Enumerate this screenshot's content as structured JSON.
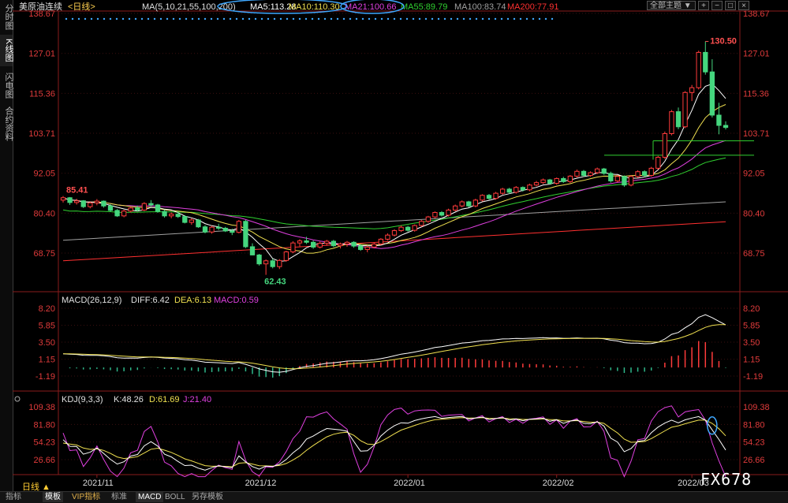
{
  "sidebar": {
    "tabs": [
      "分时图",
      "K线图",
      "闪电图",
      "合约资料"
    ],
    "active": 1
  },
  "toolbar": {
    "theme": "全部主题",
    "theme_arrow": "▼"
  },
  "main_chart": {
    "instrument": "美原油连续",
    "period": "<日线>",
    "ma_label": "MA(5,10,21,55,100,200)",
    "ma_items": [
      {
        "label": "MA5:113.28",
        "color": "#ffffff"
      },
      {
        "label": "MA10:110.30",
        "color": "#f0e050"
      },
      {
        "label": "MA21:100.66",
        "color": "#e040e0"
      },
      {
        "label": "MA55:89.79",
        "color": "#30d030"
      },
      {
        "label": "MA100:83.74",
        "color": "#a0a0a0"
      },
      {
        "label": "MA200:77.91",
        "color": "#ff3030"
      }
    ],
    "price_ticks": [
      "138.67",
      "127.01",
      "115.36",
      "103.71",
      "92.05",
      "80.40",
      "68.75"
    ],
    "high_label": "130.50",
    "low_label": "62.43",
    "start_label": "85.41"
  },
  "macd": {
    "title": "MACD(26,12,9)",
    "diff": "DIFF:6.42",
    "dea": "DEA:6.13",
    "macd": "MACD:0.59",
    "ticks": [
      "8.20",
      "5.85",
      "3.50",
      "1.15",
      "-1.19"
    ]
  },
  "kdj": {
    "title": "KDJ(9,3,3)",
    "k": "K:48.26",
    "d": "D:61.69",
    "j": "J:21.40",
    "ticks": [
      "109.38",
      "81.80",
      "54.23",
      "26.66"
    ]
  },
  "x_axis": {
    "labels": [
      "2021/11",
      "2021/12",
      "2022/01",
      "2022/02",
      "2022/03"
    ]
  },
  "bottom": {
    "period": "日线 ▲",
    "tabs": [
      "指标",
      "模板",
      "VIP指标",
      "标准",
      "MACD",
      "BOLL",
      "另存模板"
    ],
    "active_tabs": [
      1,
      4
    ]
  },
  "watermark": "FX678",
  "chart_data": {
    "type": "candlestick",
    "candles": [
      [
        84.2,
        85.4,
        83.5,
        84.9
      ],
      [
        84.9,
        85.1,
        82.8,
        83.5
      ],
      [
        83.5,
        84.6,
        82.9,
        84.0
      ],
      [
        84.0,
        84.2,
        81.9,
        82.3
      ],
      [
        82.3,
        83.7,
        81.8,
        83.4
      ],
      [
        83.4,
        84.5,
        82.7,
        83.9
      ],
      [
        83.9,
        84.1,
        82.0,
        82.5
      ],
      [
        82.5,
        83.0,
        80.8,
        81.2
      ],
      [
        81.2,
        81.6,
        79.3,
        79.6
      ],
      [
        79.6,
        81.4,
        79.2,
        81.0
      ],
      [
        81.0,
        82.3,
        80.6,
        81.9
      ],
      [
        81.9,
        82.6,
        80.9,
        81.3
      ],
      [
        81.3,
        83.6,
        81.0,
        83.2
      ],
      [
        83.2,
        84.2,
        82.3,
        82.8
      ],
      [
        82.8,
        83.1,
        80.5,
        80.9
      ],
      [
        80.9,
        81.4,
        79.1,
        79.6
      ],
      [
        79.6,
        80.6,
        78.9,
        80.1
      ],
      [
        80.1,
        80.9,
        79.0,
        79.4
      ],
      [
        79.4,
        79.8,
        77.4,
        77.7
      ],
      [
        77.7,
        78.9,
        77.0,
        78.4
      ],
      [
        78.4,
        78.7,
        76.1,
        76.4
      ],
      [
        76.4,
        76.9,
        74.5,
        74.9
      ],
      [
        74.9,
        76.7,
        74.4,
        76.3
      ],
      [
        76.3,
        77.3,
        75.5,
        76.0
      ],
      [
        76.0,
        76.4,
        74.9,
        75.2
      ],
      [
        75.2,
        75.9,
        74.0,
        74.8
      ],
      [
        74.8,
        78.4,
        74.5,
        78.0
      ],
      [
        78.0,
        78.4,
        70.2,
        70.6
      ],
      [
        70.6,
        71.6,
        68.1,
        68.2
      ],
      [
        68.2,
        68.5,
        65.1,
        65.6
      ],
      [
        65.6,
        66.9,
        62.4,
        66.5
      ],
      [
        66.5,
        67.1,
        64.3,
        64.8
      ],
      [
        64.8,
        67.0,
        64.1,
        66.6
      ],
      [
        66.6,
        69.4,
        66.2,
        69.1
      ],
      [
        69.1,
        72.2,
        68.7,
        71.7
      ],
      [
        71.7,
        72.8,
        70.7,
        72.3
      ],
      [
        72.3,
        73.5,
        71.4,
        71.9
      ],
      [
        71.9,
        72.4,
        70.0,
        70.5
      ],
      [
        70.5,
        72.1,
        70.1,
        71.6
      ],
      [
        71.6,
        72.6,
        70.9,
        72.2
      ],
      [
        72.2,
        72.6,
        70.5,
        70.9
      ],
      [
        70.9,
        71.8,
        70.1,
        71.4
      ],
      [
        71.4,
        72.3,
        70.6,
        71.9
      ],
      [
        71.9,
        72.2,
        70.3,
        70.8
      ],
      [
        70.8,
        71.3,
        69.4,
        69.8
      ],
      [
        69.8,
        70.9,
        69.0,
        70.5
      ],
      [
        70.5,
        71.8,
        70.1,
        71.4
      ],
      [
        71.4,
        73.1,
        71.0,
        72.8
      ],
      [
        72.8,
        74.5,
        72.4,
        74.0
      ],
      [
        74.0,
        75.7,
        73.6,
        75.3
      ],
      [
        75.3,
        76.8,
        74.9,
        76.3
      ],
      [
        76.3,
        76.7,
        75.0,
        75.4
      ],
      [
        75.4,
        77.1,
        75.0,
        76.8
      ],
      [
        76.8,
        78.4,
        76.4,
        78.0
      ],
      [
        78.0,
        79.6,
        77.6,
        79.3
      ],
      [
        79.3,
        80.9,
        78.9,
        80.6
      ],
      [
        80.6,
        81.0,
        79.4,
        79.8
      ],
      [
        79.8,
        81.7,
        79.4,
        81.3
      ],
      [
        81.3,
        82.9,
        80.9,
        82.5
      ],
      [
        82.5,
        84.1,
        82.1,
        83.7
      ],
      [
        83.7,
        84.0,
        82.1,
        82.5
      ],
      [
        82.5,
        84.6,
        82.1,
        84.2
      ],
      [
        84.2,
        85.9,
        83.8,
        85.6
      ],
      [
        85.6,
        86.0,
        84.3,
        84.7
      ],
      [
        84.7,
        86.6,
        84.3,
        86.2
      ],
      [
        86.2,
        87.8,
        85.8,
        87.4
      ],
      [
        87.4,
        87.8,
        86.0,
        86.5
      ],
      [
        86.5,
        88.3,
        86.1,
        87.9
      ],
      [
        87.9,
        88.2,
        86.7,
        87.2
      ],
      [
        87.2,
        89.0,
        86.8,
        88.6
      ],
      [
        88.6,
        89.8,
        88.2,
        89.3
      ],
      [
        89.3,
        90.5,
        88.9,
        90.1
      ],
      [
        90.1,
        90.4,
        88.7,
        89.1
      ],
      [
        89.1,
        90.8,
        88.7,
        90.5
      ],
      [
        90.5,
        91.0,
        89.2,
        89.6
      ],
      [
        89.6,
        91.5,
        89.2,
        91.2
      ],
      [
        91.2,
        93.1,
        90.8,
        92.6
      ],
      [
        92.6,
        93.0,
        91.0,
        91.4
      ],
      [
        91.4,
        92.6,
        91.0,
        92.2
      ],
      [
        92.2,
        93.7,
        91.8,
        93.3
      ],
      [
        93.3,
        93.6,
        91.6,
        92.0
      ],
      [
        92.0,
        92.5,
        89.3,
        89.8
      ],
      [
        89.8,
        91.5,
        89.4,
        91.1
      ],
      [
        91.1,
        91.4,
        88.1,
        88.6
      ],
      [
        88.6,
        91.5,
        88.2,
        91.1
      ],
      [
        91.1,
        92.9,
        90.7,
        92.5
      ],
      [
        92.5,
        92.9,
        90.9,
        91.4
      ],
      [
        91.4,
        93.9,
        91.0,
        93.5
      ],
      [
        93.5,
        97.1,
        93.1,
        96.7
      ],
      [
        96.7,
        104.2,
        96.2,
        103.6
      ],
      [
        103.6,
        110.5,
        103.1,
        110.0
      ],
      [
        110.0,
        111.2,
        104.9,
        105.6
      ],
      [
        105.6,
        116.0,
        105.2,
        115.6
      ],
      [
        115.6,
        117.8,
        113.1,
        117.0
      ],
      [
        117.0,
        127.8,
        116.5,
        127.3
      ],
      [
        127.3,
        130.5,
        120.8,
        121.6
      ],
      [
        121.6,
        125.3,
        108.3,
        109.0
      ],
      [
        109.0,
        112.6,
        103.4,
        106.0
      ],
      [
        106.0,
        107.2,
        104.8,
        105.4
      ]
    ],
    "ma_series": [
      "MA5",
      "MA10",
      "MA21",
      "MA55",
      "MA100",
      "MA200"
    ],
    "ylim": [
      62.43,
      138.67
    ],
    "macd_ylim": [
      -3.0,
      9.0
    ],
    "kdj_ylim": [
      0,
      115
    ]
  }
}
